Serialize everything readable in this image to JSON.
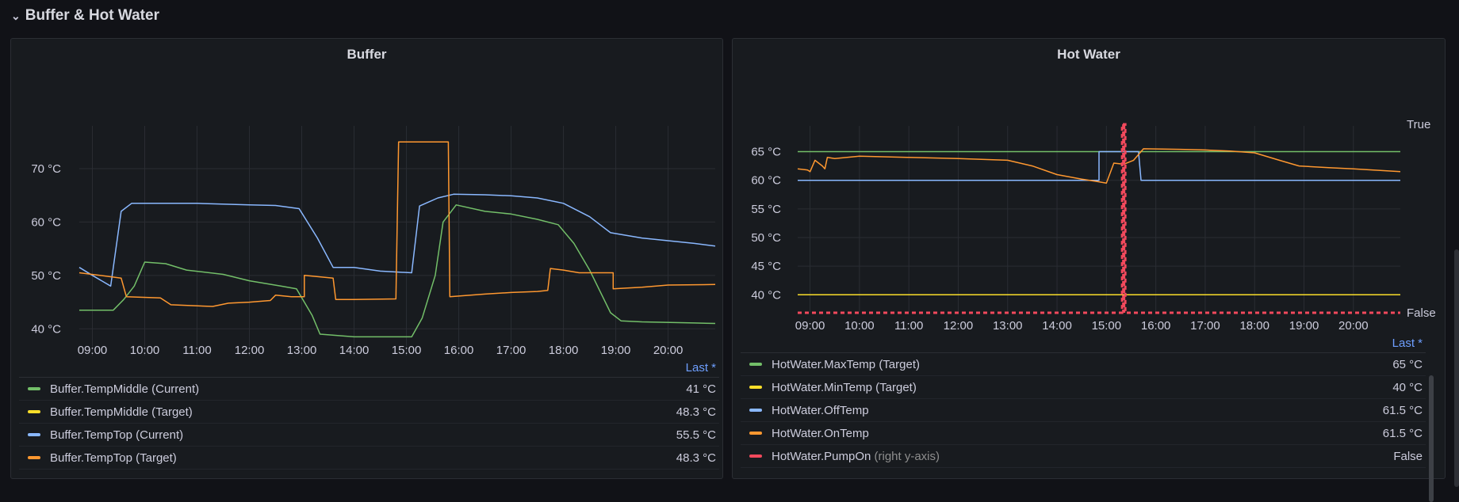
{
  "row": {
    "title": "Buffer & Hot Water"
  },
  "panels": [
    {
      "title": "Buffer",
      "legend_header": "Last *",
      "legend": [
        {
          "name": "Buffer.TempMiddle (Current)",
          "value": "41 °C",
          "color": "#73bf69"
        },
        {
          "name": "Buffer.TempMiddle (Target)",
          "value": "48.3 °C",
          "color": "#fade2a"
        },
        {
          "name": "Buffer.TempTop (Current)",
          "value": "55.5 °C",
          "color": "#8ab8ff"
        },
        {
          "name": "Buffer.TempTop (Target)",
          "value": "48.3 °C",
          "color": "#ff9830"
        }
      ]
    },
    {
      "title": "Hot Water",
      "legend_header": "Last *",
      "legend": [
        {
          "name": "HotWater.MaxTemp (Target)",
          "suffix": "",
          "value": "65 °C",
          "color": "#73bf69"
        },
        {
          "name": "HotWater.MinTemp (Target)",
          "suffix": "",
          "value": "40 °C",
          "color": "#fade2a"
        },
        {
          "name": "HotWater.OffTemp",
          "suffix": "",
          "value": "61.5 °C",
          "color": "#8ab8ff"
        },
        {
          "name": "HotWater.OnTemp",
          "suffix": "",
          "value": "61.5 °C",
          "color": "#ff9830"
        },
        {
          "name": "HotWater.PumpOn",
          "suffix": " (right y-axis)",
          "value": "False",
          "color": "#f2495c"
        }
      ]
    }
  ],
  "chart_data": [
    {
      "type": "line",
      "title": "Buffer",
      "x_ticks": [
        "09:00",
        "10:00",
        "11:00",
        "12:00",
        "13:00",
        "14:00",
        "15:00",
        "16:00",
        "17:00",
        "18:00",
        "19:00",
        "20:00"
      ],
      "y_ticks": [
        "40 °C",
        "50 °C",
        "60 °C",
        "70 °C"
      ],
      "ylim": [
        35,
        78
      ],
      "xlim": [
        8.75,
        20.9
      ],
      "series": [
        {
          "name": "Buffer.TempTop (Current)",
          "color": "#8ab8ff",
          "points": [
            [
              8.75,
              51.5
            ],
            [
              9.0,
              50
            ],
            [
              9.35,
              48
            ],
            [
              9.55,
              62
            ],
            [
              9.75,
              63.5
            ],
            [
              11.0,
              63.5
            ],
            [
              12.0,
              63.2
            ],
            [
              12.5,
              63.1
            ],
            [
              12.95,
              62.5
            ],
            [
              13.3,
              57
            ],
            [
              13.6,
              51.5
            ],
            [
              14.0,
              51.5
            ],
            [
              14.5,
              50.8
            ],
            [
              15.1,
              50.5
            ],
            [
              15.25,
              63
            ],
            [
              15.6,
              64.5
            ],
            [
              15.9,
              65.2
            ],
            [
              16.5,
              65.1
            ],
            [
              17.0,
              64.9
            ],
            [
              17.5,
              64.5
            ],
            [
              18.0,
              63.5
            ],
            [
              18.5,
              61
            ],
            [
              18.9,
              58
            ],
            [
              19.5,
              57
            ],
            [
              20.5,
              56
            ],
            [
              20.9,
              55.5
            ]
          ]
        },
        {
          "name": "Buffer.TempMiddle (Current)",
          "color": "#73bf69",
          "points": [
            [
              8.75,
              43.5
            ],
            [
              9.4,
              43.5
            ],
            [
              9.6,
              45.5
            ],
            [
              9.8,
              48
            ],
            [
              10.0,
              52.5
            ],
            [
              10.4,
              52.2
            ],
            [
              10.8,
              51
            ],
            [
              11.5,
              50.2
            ],
            [
              12.0,
              49
            ],
            [
              12.6,
              48
            ],
            [
              12.9,
              47.5
            ],
            [
              13.2,
              42.5
            ],
            [
              13.35,
              39
            ],
            [
              14.0,
              38.5
            ],
            [
              15.1,
              38.5
            ],
            [
              15.3,
              42
            ],
            [
              15.55,
              50
            ],
            [
              15.7,
              60
            ],
            [
              15.95,
              63.2
            ],
            [
              16.5,
              62
            ],
            [
              17.0,
              61.5
            ],
            [
              17.5,
              60.5
            ],
            [
              17.9,
              59.5
            ],
            [
              18.2,
              56
            ],
            [
              18.5,
              51
            ],
            [
              18.9,
              43
            ],
            [
              19.1,
              41.5
            ],
            [
              19.5,
              41.3
            ],
            [
              20.5,
              41.1
            ],
            [
              20.9,
              41
            ]
          ]
        },
        {
          "name": "Buffer.TempTop (Target)",
          "color": "#ff9830",
          "points": [
            [
              8.75,
              50.5
            ],
            [
              9.55,
              49.5
            ],
            [
              9.65,
              46
            ],
            [
              10.3,
              45.8
            ],
            [
              10.5,
              44.5
            ],
            [
              11.0,
              44.3
            ],
            [
              11.3,
              44.2
            ],
            [
              11.6,
              44.8
            ],
            [
              12.0,
              45
            ],
            [
              12.4,
              45.3
            ],
            [
              12.5,
              46.3
            ],
            [
              12.8,
              46
            ],
            [
              13.05,
              46
            ],
            [
              13.05,
              50
            ],
            [
              13.6,
              49.5
            ],
            [
              13.65,
              45.5
            ],
            [
              14.0,
              45.5
            ],
            [
              14.8,
              45.6
            ],
            [
              14.85,
              75
            ],
            [
              15.8,
              75
            ],
            [
              15.83,
              46
            ],
            [
              16.5,
              46.5
            ],
            [
              17.0,
              46.8
            ],
            [
              17.5,
              47
            ],
            [
              17.7,
              47.2
            ],
            [
              17.75,
              51.3
            ],
            [
              18.0,
              51
            ],
            [
              18.3,
              50.5
            ],
            [
              18.95,
              50.5
            ],
            [
              18.95,
              47.5
            ],
            [
              19.5,
              47.8
            ],
            [
              20.0,
              48.2
            ],
            [
              20.9,
              48.3
            ]
          ]
        }
      ]
    },
    {
      "type": "line",
      "title": "Hot Water",
      "x_ticks": [
        "09:00",
        "10:00",
        "11:00",
        "12:00",
        "13:00",
        "14:00",
        "15:00",
        "16:00",
        "17:00",
        "18:00",
        "19:00",
        "20:00"
      ],
      "y_ticks": [
        "40 °C",
        "45 °C",
        "50 °C",
        "55 °C",
        "60 °C",
        "65 °C"
      ],
      "right_y_ticks": [
        "True",
        "False"
      ],
      "ylim": [
        37,
        69.5
      ],
      "xlim": [
        8.75,
        20.95
      ],
      "series": [
        {
          "name": "HotWater.MaxTemp (Target)",
          "color": "#73bf69",
          "points": [
            [
              8.75,
              65
            ],
            [
              20.95,
              65
            ]
          ]
        },
        {
          "name": "HotWater.MinTemp (Target)",
          "color": "#fade2a",
          "points": [
            [
              8.75,
              40
            ],
            [
              20.95,
              40
            ]
          ]
        },
        {
          "name": "HotWater.OffTemp",
          "color": "#8ab8ff",
          "points": [
            [
              8.75,
              60
            ],
            [
              14.85,
              60
            ],
            [
              14.85,
              65
            ],
            [
              15.65,
              65
            ],
            [
              15.7,
              60
            ],
            [
              20.95,
              60
            ]
          ]
        },
        {
          "name": "HotWater.OnTemp",
          "color": "#ff9830",
          "points": [
            [
              8.75,
              62
            ],
            [
              8.95,
              61.8
            ],
            [
              9.0,
              61.5
            ],
            [
              9.1,
              63.5
            ],
            [
              9.25,
              62.5
            ],
            [
              9.3,
              62
            ],
            [
              9.35,
              64
            ],
            [
              9.5,
              63.8
            ],
            [
              10.0,
              64.2
            ],
            [
              11.0,
              64
            ],
            [
              12.0,
              63.8
            ],
            [
              13.0,
              63.5
            ],
            [
              13.5,
              62.5
            ],
            [
              14.0,
              61
            ],
            [
              14.5,
              60.2
            ],
            [
              14.8,
              59.8
            ],
            [
              15.0,
              59.5
            ],
            [
              15.15,
              63
            ],
            [
              15.35,
              62.8
            ],
            [
              15.55,
              63.5
            ],
            [
              15.75,
              65.5
            ],
            [
              16.5,
              65.4
            ],
            [
              17.0,
              65.3
            ],
            [
              17.5,
              65.1
            ],
            [
              18.0,
              64.8
            ],
            [
              18.5,
              63.5
            ],
            [
              18.9,
              62.5
            ],
            [
              19.5,
              62.2
            ],
            [
              20.0,
              62
            ],
            [
              20.95,
              61.5
            ]
          ]
        }
      ],
      "pump_on": {
        "name": "HotWater.PumpOn",
        "color": "#f2495c",
        "true_at": 15.35
      }
    }
  ]
}
